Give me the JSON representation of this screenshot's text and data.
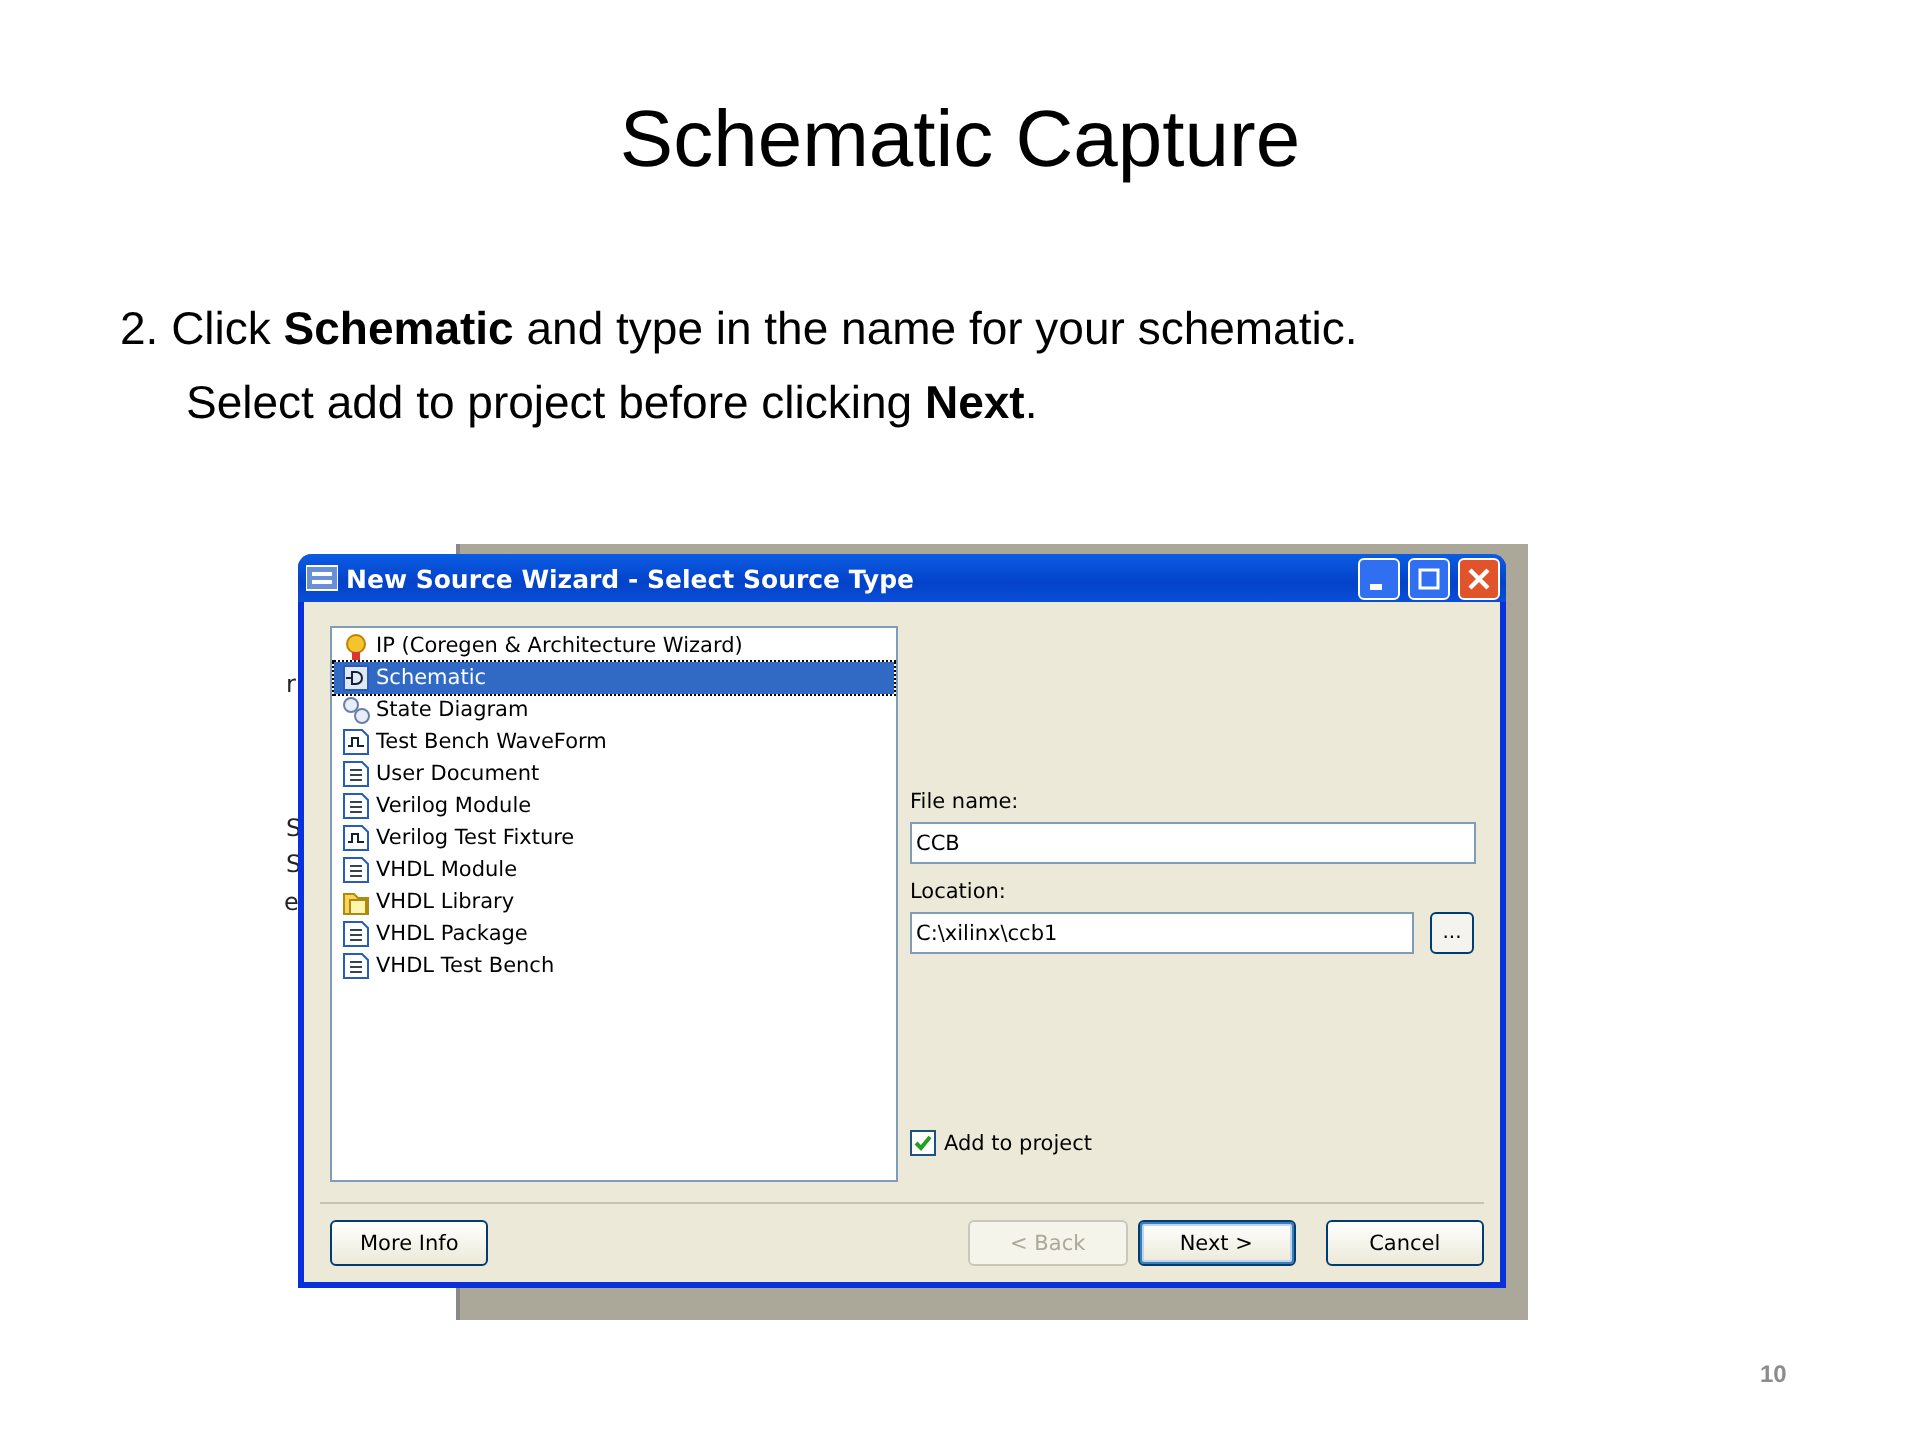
{
  "slide": {
    "title": "Schematic Capture",
    "instructions": [
      "2.  Click **Schematic** and type in the name for your schematic.",
      "Select add to project before clicking **Next**."
    ],
    "page_number": "10"
  },
  "background_window": {
    "fragments": [
      "r",
      "S",
      "S",
      "e"
    ]
  },
  "window": {
    "title": "New Source Wizard - Select Source Type"
  },
  "source_types": [
    {
      "label": "IP (Coregen & Architecture Wizard)",
      "kind": "bulb",
      "selected": false
    },
    {
      "label": "Schematic",
      "kind": "symbol",
      "selected": true
    },
    {
      "label": "State Diagram",
      "kind": "bubbles",
      "selected": false
    },
    {
      "label": "Test Bench WaveForm",
      "kind": "wave",
      "selected": false
    },
    {
      "label": "User Document",
      "kind": "doc",
      "selected": false
    },
    {
      "label": "Verilog Module",
      "kind": "doc",
      "selected": false
    },
    {
      "label": "Verilog Test Fixture",
      "kind": "wave",
      "selected": false
    },
    {
      "label": "VHDL Module",
      "kind": "doc",
      "selected": false
    },
    {
      "label": "VHDL Library",
      "kind": "folder",
      "selected": false
    },
    {
      "label": "VHDL Package",
      "kind": "doc",
      "selected": false
    },
    {
      "label": "VHDL Test Bench",
      "kind": "doc",
      "selected": false
    }
  ],
  "file_name": {
    "label": "File name:",
    "value": "CCB"
  },
  "location": {
    "label": "Location:",
    "value": "C:\\xilinx\\ccb1",
    "browse": "..."
  },
  "add_to_project": {
    "label": "Add to project",
    "checked": true
  },
  "buttons": [
    {
      "label": "More Info",
      "disabled": false,
      "default": false
    },
    {
      "label": "< Back",
      "disabled": true,
      "default": false
    },
    {
      "label": "Next >",
      "disabled": false,
      "default": true
    },
    {
      "label": "Cancel",
      "disabled": false,
      "default": false
    }
  ]
}
